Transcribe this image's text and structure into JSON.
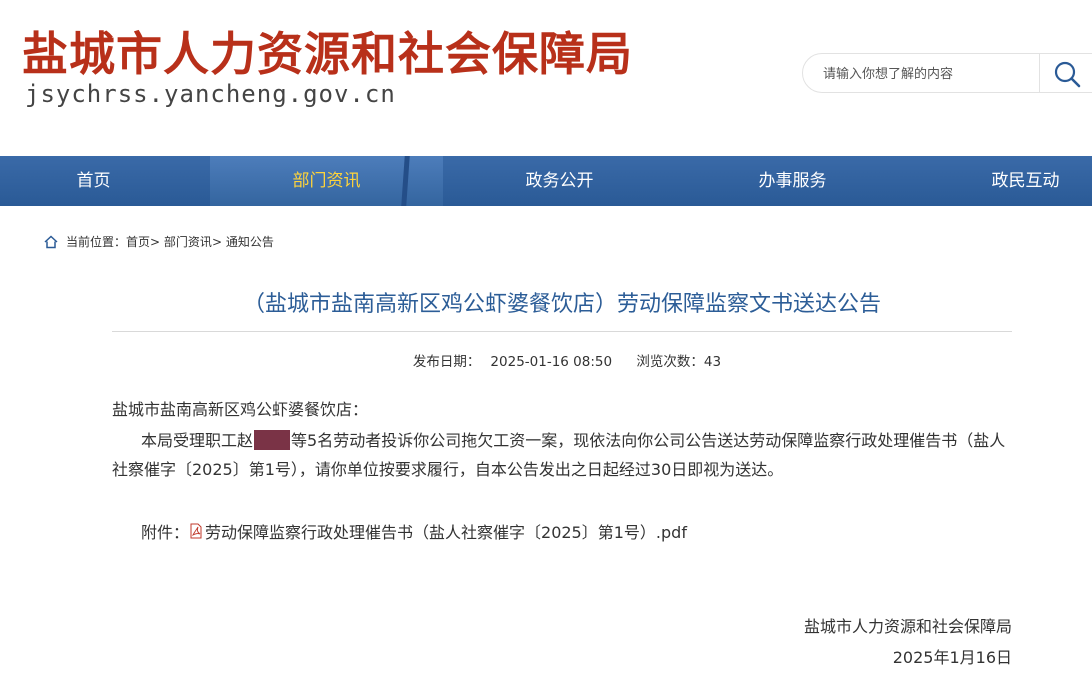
{
  "header": {
    "site_title": "盐城市人力资源和社会保障局",
    "site_domain": "jsychrss.yancheng.gov.cn",
    "search_placeholder": "请输入你想了解的内容"
  },
  "nav": {
    "items": [
      {
        "label": "首页"
      },
      {
        "label": "部门资讯"
      },
      {
        "label": "政务公开"
      },
      {
        "label": "办事服务"
      },
      {
        "label": "政民互动"
      }
    ],
    "active_index": 1
  },
  "breadcrumb": {
    "prefix": "当前位置：",
    "items": [
      "首页",
      "部门资讯",
      "通知公告"
    ],
    "separator": ">"
  },
  "article": {
    "title": "（盐城市盐南高新区鸡公虾婆餐饮店）劳动保障监察文书送达公告",
    "publish_date_label": "发布日期：",
    "publish_date": "2025-01-16 08:50",
    "views_label": "浏览次数：",
    "views": "43",
    "salutation": "盐城市盐南高新区鸡公虾婆餐饮店：",
    "para_before_redaction": "本局受理职工赵",
    "para_after_redaction": "等5名劳动者投诉你公司拖欠工资一案，现依法向你公司公告送达劳动保障监察行政处理催告书（盐人社察催字〔2025〕第1号），请你单位按要求履行，自本公告发出之日起经过30日即视为送达。",
    "attachment_label": "附件：",
    "attachment_name": "劳动保障监察行政处理催告书（盐人社察催字〔2025〕第1号）.pdf",
    "signature_org": "盐城市人力资源和社会保障局",
    "signature_date": "2025年1月16日"
  },
  "colors": {
    "title_red": "#b8301a",
    "nav_blue": "#2f5f9c",
    "nav_active_text": "#ffd43a",
    "article_title_blue": "#2c5d97"
  }
}
